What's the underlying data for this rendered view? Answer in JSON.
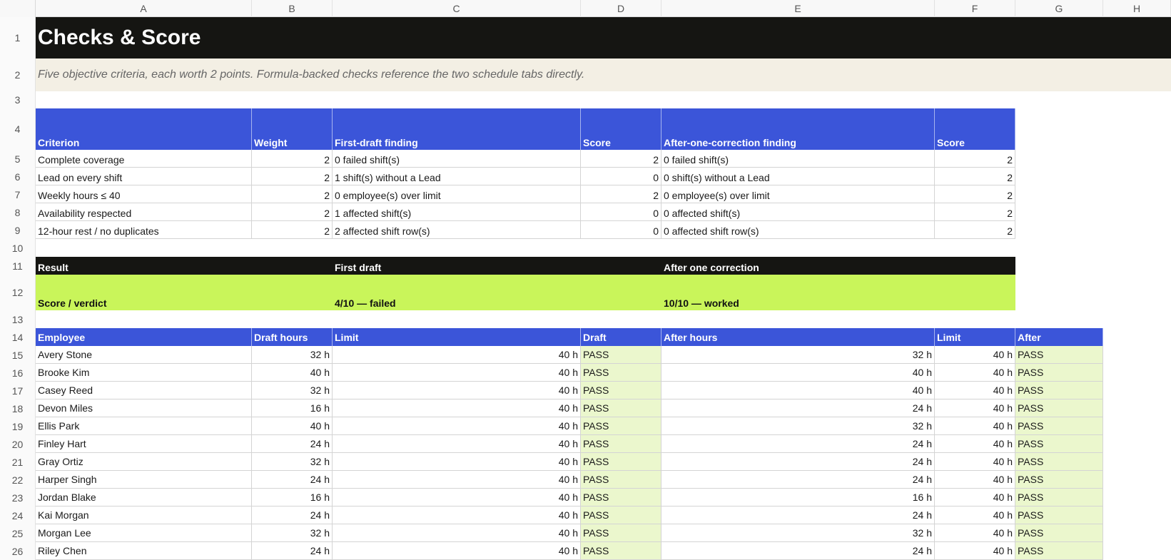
{
  "columns": [
    "A",
    "B",
    "C",
    "D",
    "E",
    "F",
    "G",
    "H"
  ],
  "row_numbers": [
    "1",
    "2",
    "3",
    "4",
    "5",
    "6",
    "7",
    "8",
    "9",
    "10",
    "11",
    "12",
    "13",
    "14",
    "15",
    "16",
    "17",
    "18",
    "19",
    "20",
    "21",
    "22",
    "23",
    "24",
    "25",
    "26"
  ],
  "title": "Checks & Score",
  "subtitle": "Five objective criteria, each worth 2 points. Formula-backed checks reference the two schedule tabs directly.",
  "criteria_table": {
    "headers": [
      "Criterion",
      "Weight",
      "First-draft finding",
      "Score",
      "After-one-correction finding",
      "Score"
    ],
    "rows": [
      [
        "Complete coverage",
        "2",
        "0 failed shift(s)",
        "2",
        "0 failed shift(s)",
        "2"
      ],
      [
        "Lead on every shift",
        "2",
        "1 shift(s) without a Lead",
        "0",
        "0 shift(s) without a Lead",
        "2"
      ],
      [
        "Weekly hours ≤ 40",
        "2",
        "0 employee(s) over limit",
        "2",
        "0 employee(s) over limit",
        "2"
      ],
      [
        "Availability respected",
        "2",
        "1 affected shift(s)",
        "0",
        "0 affected shift(s)",
        "2"
      ],
      [
        "12-hour rest / no duplicates",
        "2",
        "2 affected shift row(s)",
        "0",
        "0 affected shift row(s)",
        "2"
      ]
    ]
  },
  "result": {
    "headers": [
      "Result",
      "First draft",
      "After one correction"
    ],
    "row": [
      "Score / verdict",
      "4/10 — failed",
      "10/10 — worked"
    ]
  },
  "hours_table": {
    "headers": [
      "Employee",
      "Draft hours",
      "Limit",
      "Draft",
      "After hours",
      "Limit",
      "After"
    ],
    "rows": [
      [
        "Avery Stone",
        "32 h",
        "40 h",
        "PASS",
        "32 h",
        "40 h",
        "PASS"
      ],
      [
        "Brooke Kim",
        "40 h",
        "40 h",
        "PASS",
        "40 h",
        "40 h",
        "PASS"
      ],
      [
        "Casey Reed",
        "32 h",
        "40 h",
        "PASS",
        "40 h",
        "40 h",
        "PASS"
      ],
      [
        "Devon Miles",
        "16 h",
        "40 h",
        "PASS",
        "24 h",
        "40 h",
        "PASS"
      ],
      [
        "Ellis Park",
        "40 h",
        "40 h",
        "PASS",
        "32 h",
        "40 h",
        "PASS"
      ],
      [
        "Finley Hart",
        "24 h",
        "40 h",
        "PASS",
        "24 h",
        "40 h",
        "PASS"
      ],
      [
        "Gray Ortiz",
        "32 h",
        "40 h",
        "PASS",
        "24 h",
        "40 h",
        "PASS"
      ],
      [
        "Harper Singh",
        "24 h",
        "40 h",
        "PASS",
        "24 h",
        "40 h",
        "PASS"
      ],
      [
        "Jordan Blake",
        "16 h",
        "40 h",
        "PASS",
        "16 h",
        "40 h",
        "PASS"
      ],
      [
        "Kai Morgan",
        "24 h",
        "40 h",
        "PASS",
        "24 h",
        "40 h",
        "PASS"
      ],
      [
        "Morgan Lee",
        "32 h",
        "40 h",
        "PASS",
        "32 h",
        "40 h",
        "PASS"
      ],
      [
        "Riley Chen",
        "24 h",
        "40 h",
        "PASS",
        "24 h",
        "40 h",
        "PASS"
      ]
    ]
  },
  "colors": {
    "title_band": "#151512",
    "note_band": "#f3efe4",
    "header_blue": "#3b55d9",
    "verdict_lime": "#c9f55a",
    "pass_fill": "#ebf7cd"
  }
}
